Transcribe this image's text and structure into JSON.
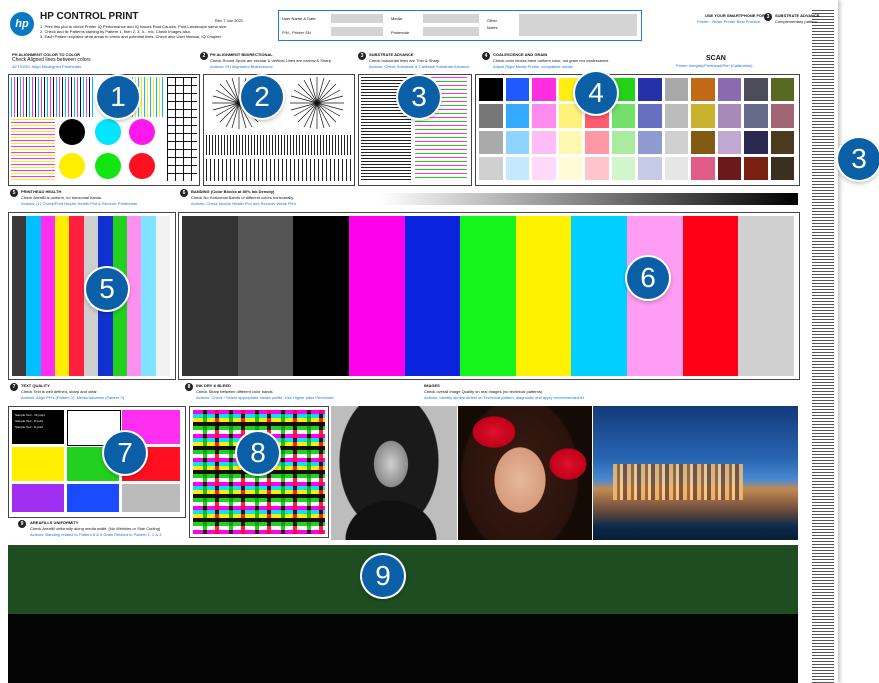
{
  "header": {
    "logo_text": "hp",
    "title": "HP CONTROL PRINT",
    "rev": "Rev 7 Jan 2021",
    "instructions": [
      "1. Print this plot to check Printer IQ Performance and IQ Issues Root Causes. Print Landscape same size.",
      "2. Check and fix Patterns starting by Pattern 1, then 2, 3, 4... etc. Check Images also.",
      "3. Each Pattern explains what areas to check and potential fixes. Check also User Manual, IQ Chapter."
    ],
    "form": {
      "user_label": "User Name & Date",
      "pn_label": "P/N - Printer SN",
      "media_label": "Media",
      "printmode_label": "Printmode",
      "other_label": "Other",
      "notes_label": "Notes"
    },
    "smartphone": "USE YOUR SMARTPHONE FOR",
    "smartphone_sub": "Printer - Noise Printer Best Practice",
    "substrate_title": "SUBSTRATE ADVANCE",
    "substrate_sub": "Complementary pattern"
  },
  "sections": {
    "s1": {
      "title": "PH ALIGNMENT COLOR TO COLOR",
      "desc": "Check Aligned lines between colors",
      "action": "ACTIONS: Align Misaligned Printheads"
    },
    "s2": {
      "num": "2",
      "title": "PH ALIGNMENT BIDIRECTIONAL",
      "desc": "Check Round Spots are circular & Vertical Lines are narrow & Sharp",
      "action": "Actions: PH Alignment Bidirectional"
    },
    "s3": {
      "num": "3",
      "title": "SUBSTRATE ADVANCE",
      "desc": "Check horizontal lines are Thin & Sharp",
      "action": "Actions: Check Substrate & Calibrate Substrate Advance"
    },
    "s4": {
      "num": "4",
      "title": "COALESCENCE AND GRAIN",
      "desc": "Check color blocks have uniform color, not grain nor coalescence.",
      "action": "Adjust Right Media Profile, compatible media",
      "scan": "SCAN",
      "scan_sub": "Printer Integrity/Printhead/Pen (Calibration)"
    },
    "s5": {
      "num": "5",
      "title": "PRINTHEAD HEALTH",
      "desc": "Check Areafill is uniform, no horizontal bands.",
      "action": "Actions: (1) Check/Print Nozzle Health Plot & Recover Printheads"
    },
    "s6": {
      "num": "6",
      "title": "BANDING",
      "title_note": "(Color Blocks at 80% Ink Density)",
      "desc": "Check No Horizontal Bands of different colors horizontally.",
      "action": "Actions: Check Nozzle Health Plot and Recover Weak PH's"
    },
    "s7": {
      "num": "7",
      "title": "TEXT QUALITY",
      "desc": "Check Text is well defined, sharp and clear.",
      "action": "Actions: Align PH's (Pattern 1), Media Advance (Pattern 3)"
    },
    "s8": {
      "num": "8",
      "title": "BLEED",
      "title_prefix": "INK DRY & BLEED",
      "desc": "Check Sharp between different color bands",
      "action": "Actions: Check / Select appropriate media profile, Use Higher pass Printmode"
    },
    "images": {
      "title": "IMAGES",
      "desc": "Check overall Image Quality on real Images (no technical patterns)",
      "action": "Actions: Identify similar defect on Technical pattern, diagnostic and apply recommended fix"
    },
    "s9": {
      "num": "9",
      "title": "AREAFILLS UNIFORMITY",
      "desc": "Check Areafill uniformity along media width. (No Wrinkles or Side Curling)",
      "action": "Actions: Banding related to Pattern 5 & 6   Grain Related to Pattern 1, 2 & 3"
    }
  },
  "text_samples": [
    "Sample Text - 10 point",
    "Sample Text - 8 point",
    "Sample Text - 6 point"
  ],
  "badges": {
    "b1": "1",
    "b2": "2",
    "b3": "3",
    "b3r": "3",
    "b4": "4",
    "b5": "5",
    "b6": "6",
    "b7": "7",
    "b8": "8",
    "b9": "9"
  },
  "colors": {
    "badge": "#0a5fa6",
    "accent_blue": "#1a73d9",
    "areafill_green": "#1f4d22",
    "areafill_black": "#050505"
  },
  "ph_health_bars": [
    "#3a3a3a",
    "#00bfff",
    "#ff2ef0",
    "#ffee00",
    "#ff2040",
    "#cfcfcf",
    "#1230d0",
    "#22d020",
    "#ff90f0",
    "#7fe3ff",
    "#f2f2f2"
  ],
  "banding_blocks": [
    "#333333",
    "#555555",
    "#000000",
    "#ff00ea",
    "#0a24e0",
    "#16f51a",
    "#fff200",
    "#00cfff",
    "#ff9cf3",
    "#ff0014",
    "#d0d0d0"
  ],
  "swatches": [
    [
      "#000000",
      "#1f5aff",
      "#ff2ee0",
      "#ffee10",
      "#ff1a30",
      "#23d21a",
      "#2531a8",
      "#a9a9a9",
      "#c06a16",
      "#8c6aaf",
      "#4c4c5a",
      "#586a22"
    ],
    [
      "#777777",
      "#33a9ff",
      "#ff8af0",
      "#fff27a",
      "#ff5c70",
      "#72e06a",
      "#6570c0",
      "#bcbcbc",
      "#c9b22d",
      "#a78ab8",
      "#65698a",
      "#a06676"
    ],
    [
      "#aaaaaa",
      "#8fd3ff",
      "#ffbdf6",
      "#fff8b0",
      "#ff97a5",
      "#a9eca0",
      "#8f9ad0",
      "#d0d0d0",
      "#7f5a10",
      "#c0a8d0",
      "#2a2a50",
      "#4a3a20"
    ],
    [
      "#cfcfcf",
      "#c4e9ff",
      "#ffd9fa",
      "#fffbd6",
      "#ffc4cc",
      "#d3f5cc",
      "#c6cbe8",
      "#e6e6e6",
      "#e25c8a",
      "#6a1a1a",
      "#7a2010",
      "#3a3020"
    ]
  ],
  "bleed_colors": [
    "#ff00ea",
    "#00e5ff",
    "#ffee00",
    "#22d020",
    "#111111",
    "#ff2040",
    "#1230d0"
  ]
}
